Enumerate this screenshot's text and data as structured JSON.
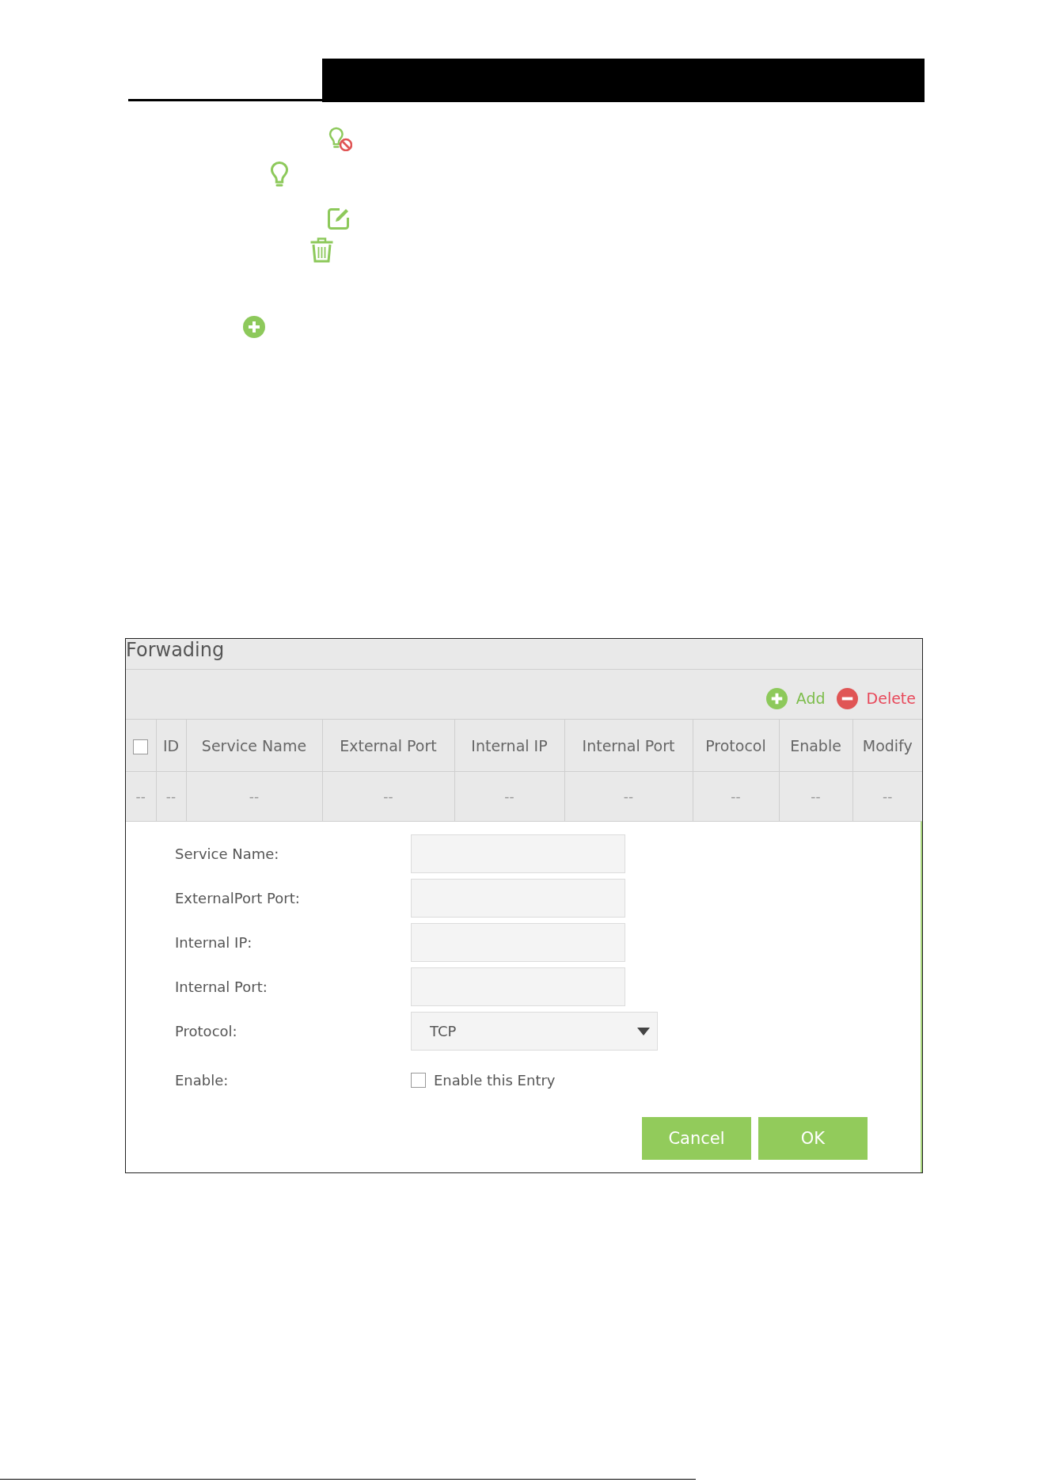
{
  "inline_icons": [
    {
      "kind": "bulb_blocked"
    },
    {
      "kind": "bulb"
    },
    {
      "kind": "edit"
    },
    {
      "kind": "trash"
    },
    {
      "kind": "add"
    }
  ],
  "panel": {
    "title": "Forwading",
    "toolbar": [
      {
        "kind": "add",
        "label": "Add"
      },
      {
        "kind": "delete",
        "label": "Delete"
      }
    ],
    "table": {
      "select_all": {
        "checked": false
      },
      "columns": [
        "",
        "ID",
        "Service Name",
        "External Port",
        "Internal IP",
        "Internal Port",
        "Protocol",
        "Enable",
        "Modify"
      ],
      "rows": [
        [
          "--",
          "--",
          "--",
          "--",
          "--",
          "--",
          "--",
          "--",
          "--"
        ]
      ]
    },
    "form": {
      "fields": [
        {
          "kind": "text",
          "label": "Service Name:"
        },
        {
          "kind": "text",
          "label": "ExternalPort Port:"
        },
        {
          "kind": "text",
          "label": "Internal IP:"
        },
        {
          "kind": "text",
          "label": "Internal Port:"
        },
        {
          "kind": "select",
          "label": "Protocol:",
          "value": "TCP"
        },
        {
          "kind": "checkbox",
          "label": "Enable:",
          "option": "Enable this Entry",
          "checked": false
        }
      ],
      "buttons": [
        "Cancel",
        "OK"
      ]
    }
  }
}
